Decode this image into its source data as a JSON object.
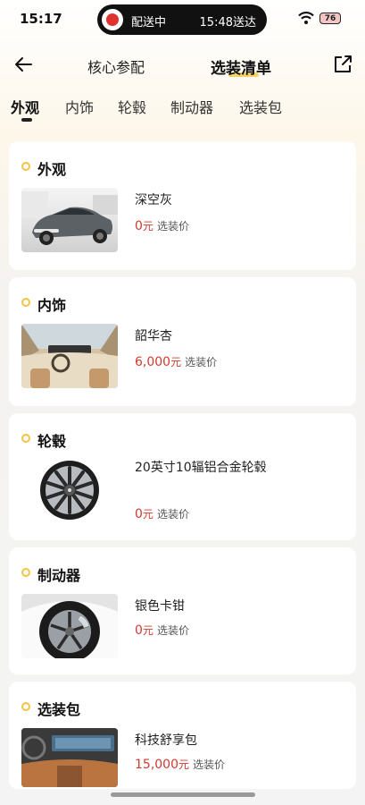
{
  "status_bar": {
    "time": "15:17",
    "island_left": "配送中",
    "island_right": "15:48送达",
    "battery": "76"
  },
  "nav": {
    "tab1": "核心参配",
    "tab2": "选装清单"
  },
  "tabs": [
    "外观",
    "内饰",
    "轮毂",
    "制动器",
    "选装包"
  ],
  "sections": [
    {
      "title": "外观",
      "item": "深空灰",
      "price": "0",
      "currency": "元",
      "suffix": "选装价"
    },
    {
      "title": "内饰",
      "item": "韶华杏",
      "price": "6,000",
      "currency": "元",
      "suffix": "选装价"
    },
    {
      "title": "轮毂",
      "item": "20英寸10辐铝合金轮毂",
      "price": "0",
      "currency": "元",
      "suffix": "选装价"
    },
    {
      "title": "制动器",
      "item": "银色卡钳",
      "price": "0",
      "currency": "元",
      "suffix": "选装价"
    },
    {
      "title": "选装包",
      "item": "科技舒享包",
      "price": "15,000",
      "currency": "元",
      "suffix": "选装价"
    }
  ]
}
